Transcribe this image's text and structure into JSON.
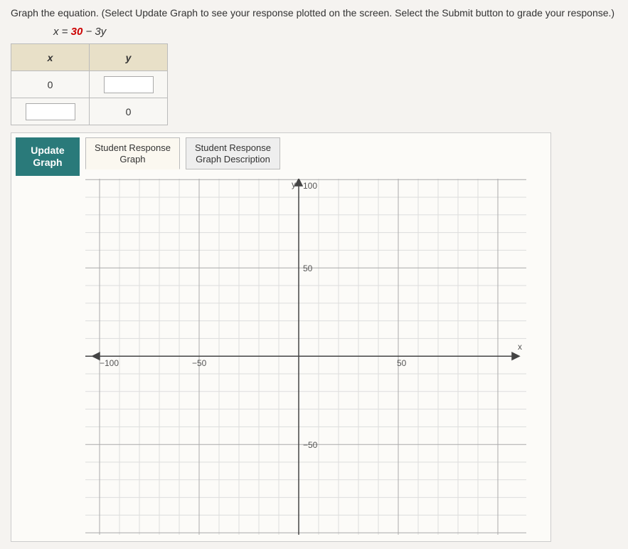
{
  "instructions": "Graph the equation. (Select Update Graph to see your response plotted on the screen. Select the Submit button to grade your response.)",
  "equation": {
    "lhs": "x",
    "eq": " = ",
    "rhs1": "30",
    "rhs2": " − 3y"
  },
  "table": {
    "head_x": "x",
    "head_y": "y",
    "r1_x": "0",
    "r1_y": "",
    "r2_x": "",
    "r2_y": "0"
  },
  "buttons": {
    "update_l1": "Update",
    "update_l2": "Graph"
  },
  "tabs": {
    "t1_l1": "Student Response",
    "t1_l2": "Graph",
    "t2_l1": "Student Response",
    "t2_l2": "Graph Description"
  },
  "axis": {
    "y_label": "y",
    "x_label": "x",
    "y100": "100",
    "y50": "50",
    "yn50": "−50",
    "xn100": "−100",
    "xn50": "−50",
    "x50": "50"
  },
  "chart_data": {
    "type": "scatter",
    "title": "",
    "xlabel": "x",
    "ylabel": "y",
    "xlim": [
      -100,
      100
    ],
    "ylim": [
      -100,
      100
    ],
    "xticks": [
      -100,
      -50,
      0,
      50,
      100
    ],
    "yticks": [
      -100,
      -50,
      0,
      50,
      100
    ],
    "grid_step": 10,
    "series": []
  }
}
